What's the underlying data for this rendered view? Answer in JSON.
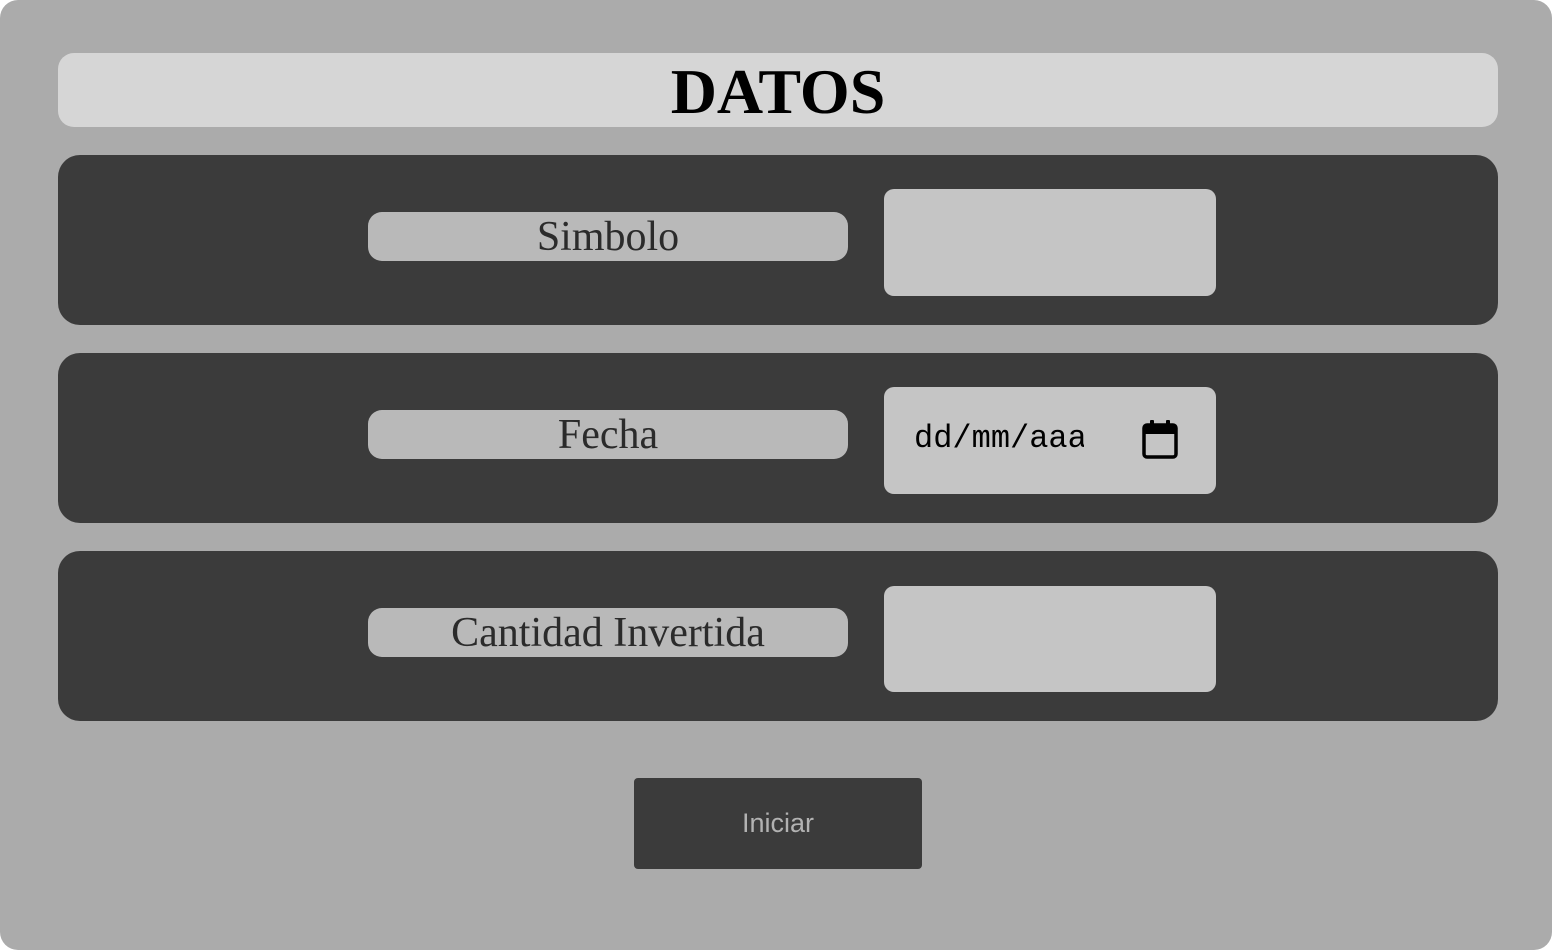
{
  "header": {
    "title": "DATOS"
  },
  "form": {
    "fields": [
      {
        "label": "Simbolo",
        "value": "",
        "type": "text"
      },
      {
        "label": "Fecha",
        "value": "",
        "placeholder": "dd/mm/aaaa",
        "type": "date"
      },
      {
        "label": "Cantidad Invertida",
        "value": "",
        "type": "number"
      }
    ],
    "submit_label": "Iniciar"
  },
  "icons": {
    "date_picker": "calendar-icon"
  },
  "colors": {
    "panel_background": "#ababab",
    "title_background": "#d6d6d6",
    "row_background": "#3b3b3b",
    "label_background": "#b9b9b9",
    "input_background": "#c5c5c5",
    "button_background": "#3b3b3b",
    "button_text": "#b2b2b2"
  }
}
